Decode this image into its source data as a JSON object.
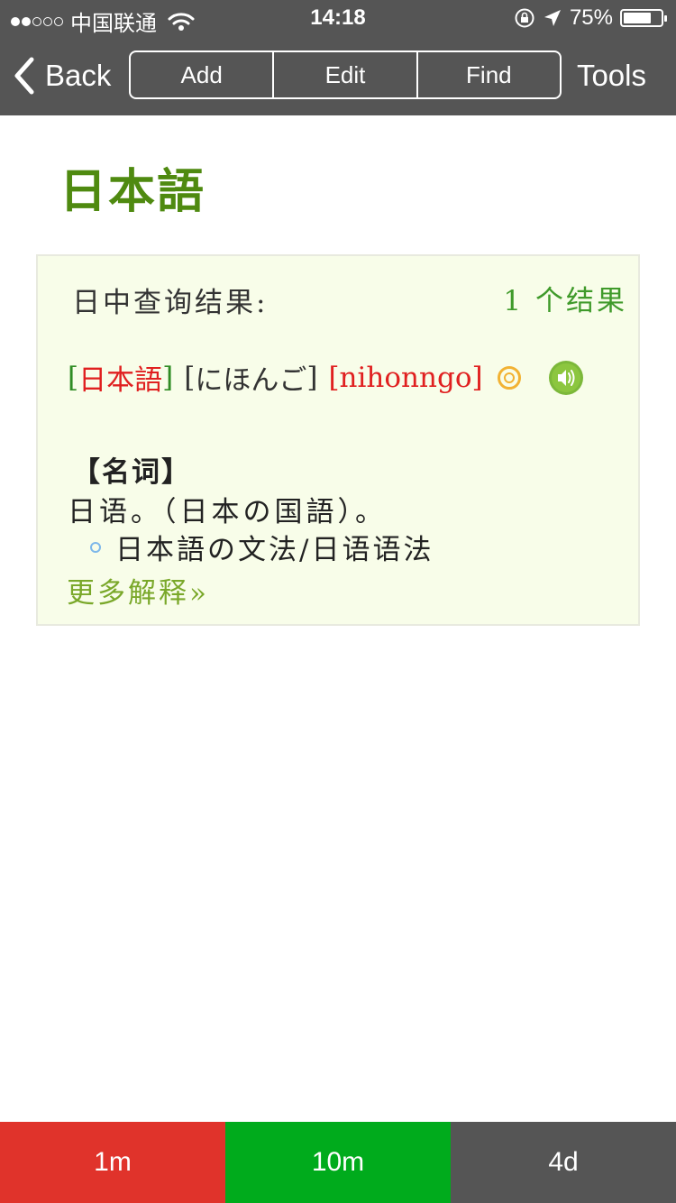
{
  "status_bar": {
    "carrier": "中国联通",
    "time": "14:18",
    "battery": "75%",
    "battery_level": 0.75,
    "signal_bars_filled": 2,
    "signal_bars_total": 5
  },
  "nav": {
    "back_label": "Back",
    "segments": [
      "Add",
      "Edit",
      "Find"
    ],
    "tools_label": "Tools"
  },
  "headword": "日本語",
  "result": {
    "query_label": "日中查询结果:",
    "count_label": "1 个结果",
    "entry": {
      "word": "日本語",
      "kana": "にほんご",
      "romaji": "nihonngo",
      "bracket_open": "[",
      "bracket_close": "]"
    },
    "part_of_speech": "【名词】",
    "definition": "日语。（日本の国語）。",
    "example": "日本語の文法/日语语法",
    "more_link": "更多解释»"
  },
  "bottom_bar": {
    "buttons": [
      {
        "label": "1m",
        "color": "#e0332b"
      },
      {
        "label": "10m",
        "color": "#00ab1c"
      },
      {
        "label": "4d",
        "color": "#555555"
      }
    ]
  },
  "colors": {
    "bar_bg": "#555555",
    "headword": "#4f8a10",
    "card_bg": "#f8fde9",
    "accent_green": "#2f8c24",
    "accent_red": "#e02020",
    "more_link": "#7aa82a"
  },
  "icons": {
    "back": "chevron-left-icon",
    "wifi": "wifi-icon",
    "rotation_lock": "rotation-lock-icon",
    "location": "location-arrow-icon",
    "battery": "battery-icon",
    "frequency_mark": "double-circle-icon",
    "pronounce": "speaker-icon",
    "example_bullet": "bullet-icon"
  }
}
